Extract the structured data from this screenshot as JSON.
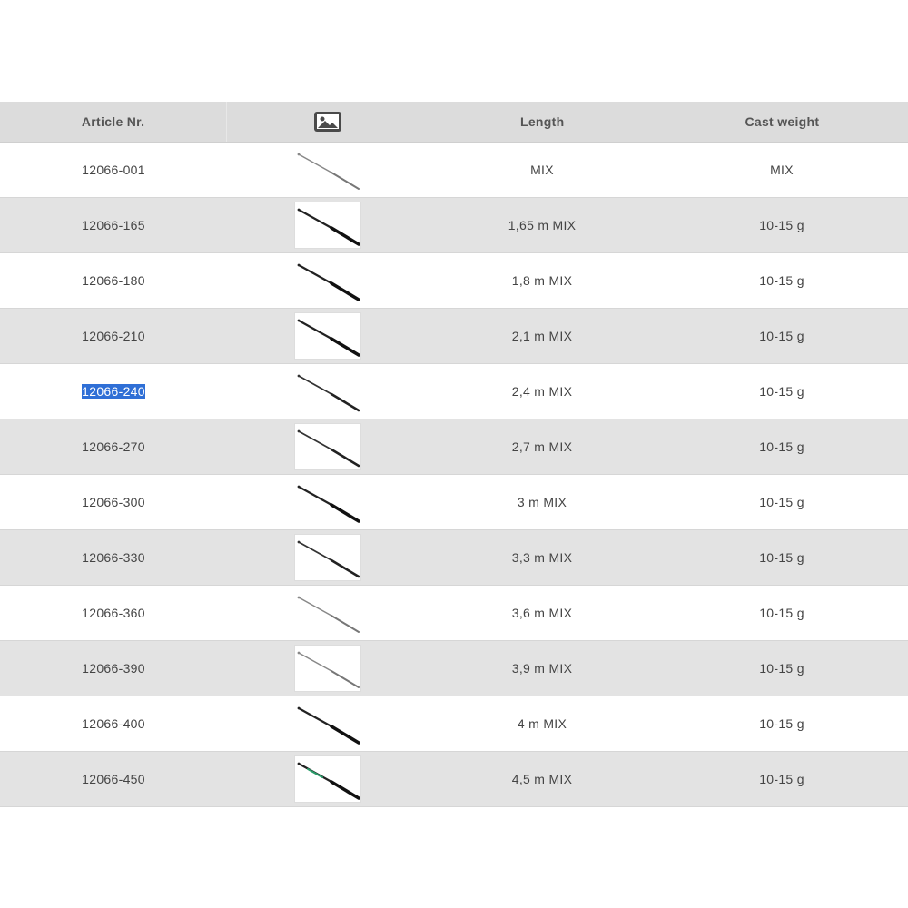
{
  "table": {
    "headers": {
      "article": "Article Nr.",
      "image_icon": "image-icon",
      "length": "Length",
      "cast_weight": "Cast weight"
    },
    "rows": [
      {
        "article": "12066-001",
        "length": "MIX",
        "cast_weight": "MIX",
        "thumb_style": "thin-grey"
      },
      {
        "article": "12066-165",
        "length": "1,65 m MIX",
        "cast_weight": "10-15 g",
        "thumb_style": "thick-black"
      },
      {
        "article": "12066-180",
        "length": "1,8 m MIX",
        "cast_weight": "10-15 g",
        "thumb_style": "thick-black"
      },
      {
        "article": "12066-210",
        "length": "2,1 m MIX",
        "cast_weight": "10-15 g",
        "thumb_style": "thick-black"
      },
      {
        "article": "12066-240",
        "length": "2,4 m MIX",
        "cast_weight": "10-15 g",
        "thumb_style": "medium-black",
        "selected": true
      },
      {
        "article": "12066-270",
        "length": "2,7 m MIX",
        "cast_weight": "10-15 g",
        "thumb_style": "medium-black"
      },
      {
        "article": "12066-300",
        "length": "3 m MIX",
        "cast_weight": "10-15 g",
        "thumb_style": "thick-black"
      },
      {
        "article": "12066-330",
        "length": "3,3 m MIX",
        "cast_weight": "10-15 g",
        "thumb_style": "medium-black"
      },
      {
        "article": "12066-360",
        "length": "3,6 m MIX",
        "cast_weight": "10-15 g",
        "thumb_style": "thin-grey"
      },
      {
        "article": "12066-390",
        "length": "3,9 m MIX",
        "cast_weight": "10-15 g",
        "thumb_style": "thin-grey"
      },
      {
        "article": "12066-400",
        "length": "4 m MIX",
        "cast_weight": "10-15 g",
        "thumb_style": "thick-black"
      },
      {
        "article": "12066-450",
        "length": "4,5 m MIX",
        "cast_weight": "10-15 g",
        "thumb_style": "thick-green"
      }
    ],
    "colors": {
      "header_bg": "#dcdcdc",
      "alt_row_bg": "#e3e3e3",
      "selection": "#2f6fd6",
      "text": "#444444"
    }
  }
}
